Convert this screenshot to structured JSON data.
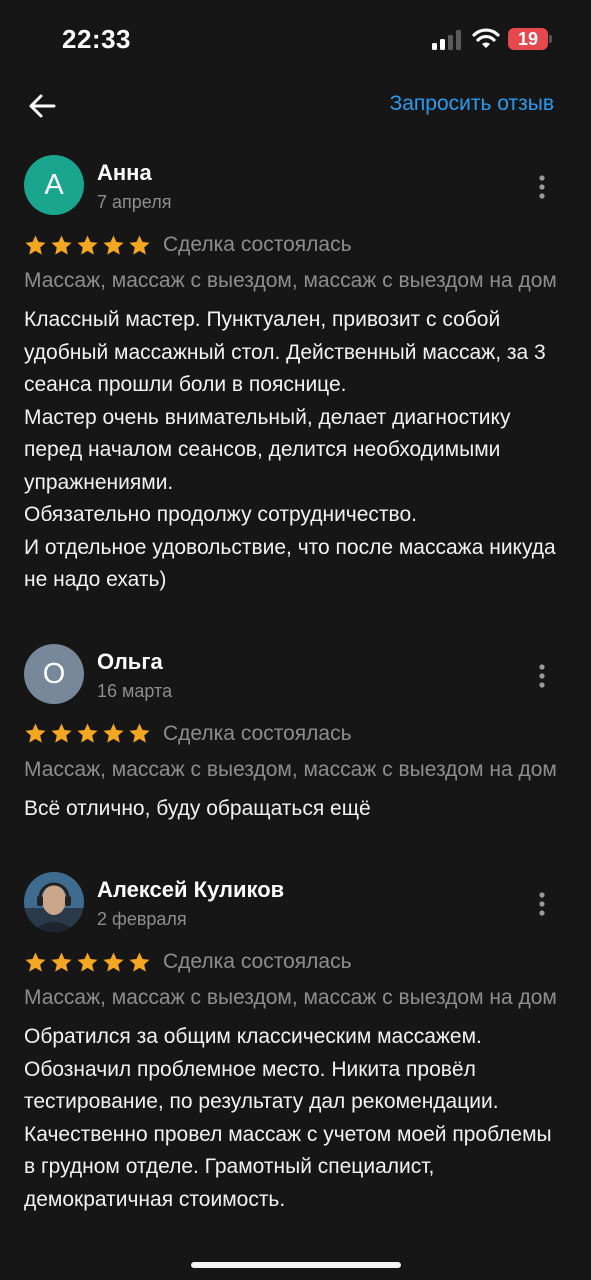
{
  "status_bar": {
    "time": "22:33",
    "battery": "19"
  },
  "colors": {
    "background": "#161616",
    "accent_link": "#2b9bf0",
    "star": "#f5a623",
    "battery_low": "#e5484d",
    "avatar_anna": "#19a58e",
    "avatar_olga": "#76889a"
  },
  "header": {
    "back_icon": "arrow-left-icon",
    "request_review_label": "Запросить отзыв"
  },
  "reviews": [
    {
      "author": "Анна",
      "initial": "А",
      "date": "7 апреля",
      "rating": 5,
      "deal_status": "Сделка состоялась",
      "services": "Массаж, массаж с выездом, массаж с выездом на дом",
      "text": "Классный мастер. Пунктуален, привозит с собой удобный массажный стол. Действенный массаж, за 3 сеанса прошли боли в пояснице.\nМастер очень внимательный, делает диагностику перед началом сеансов, делится необходимыми упражнениями.\nОбязательно продолжу сотрудничество.\n И отдельное удовольствие, что после массажа никуда не надо ехать)"
    },
    {
      "author": "Ольга",
      "initial": "О",
      "date": "16 марта",
      "rating": 5,
      "deal_status": "Сделка состоялась",
      "services": "Массаж, массаж с выездом, массаж с выездом на дом",
      "text": "Всё отлично, буду обращаться ещё"
    },
    {
      "author": "Алексей Куликов",
      "initial": "",
      "date": "2 февраля",
      "rating": 5,
      "deal_status": "Сделка состоялась",
      "services": "Массаж, массаж с выездом, массаж с выездом на дом",
      "text": "Обратился за общим классическим массажем. Обозначил проблемное место. Никита провёл тестирование, по результату дал рекомендации. Качественно провел массаж с учетом моей проблемы в грудном отделе. Грамотный специалист, демократичная стоимость."
    }
  ]
}
